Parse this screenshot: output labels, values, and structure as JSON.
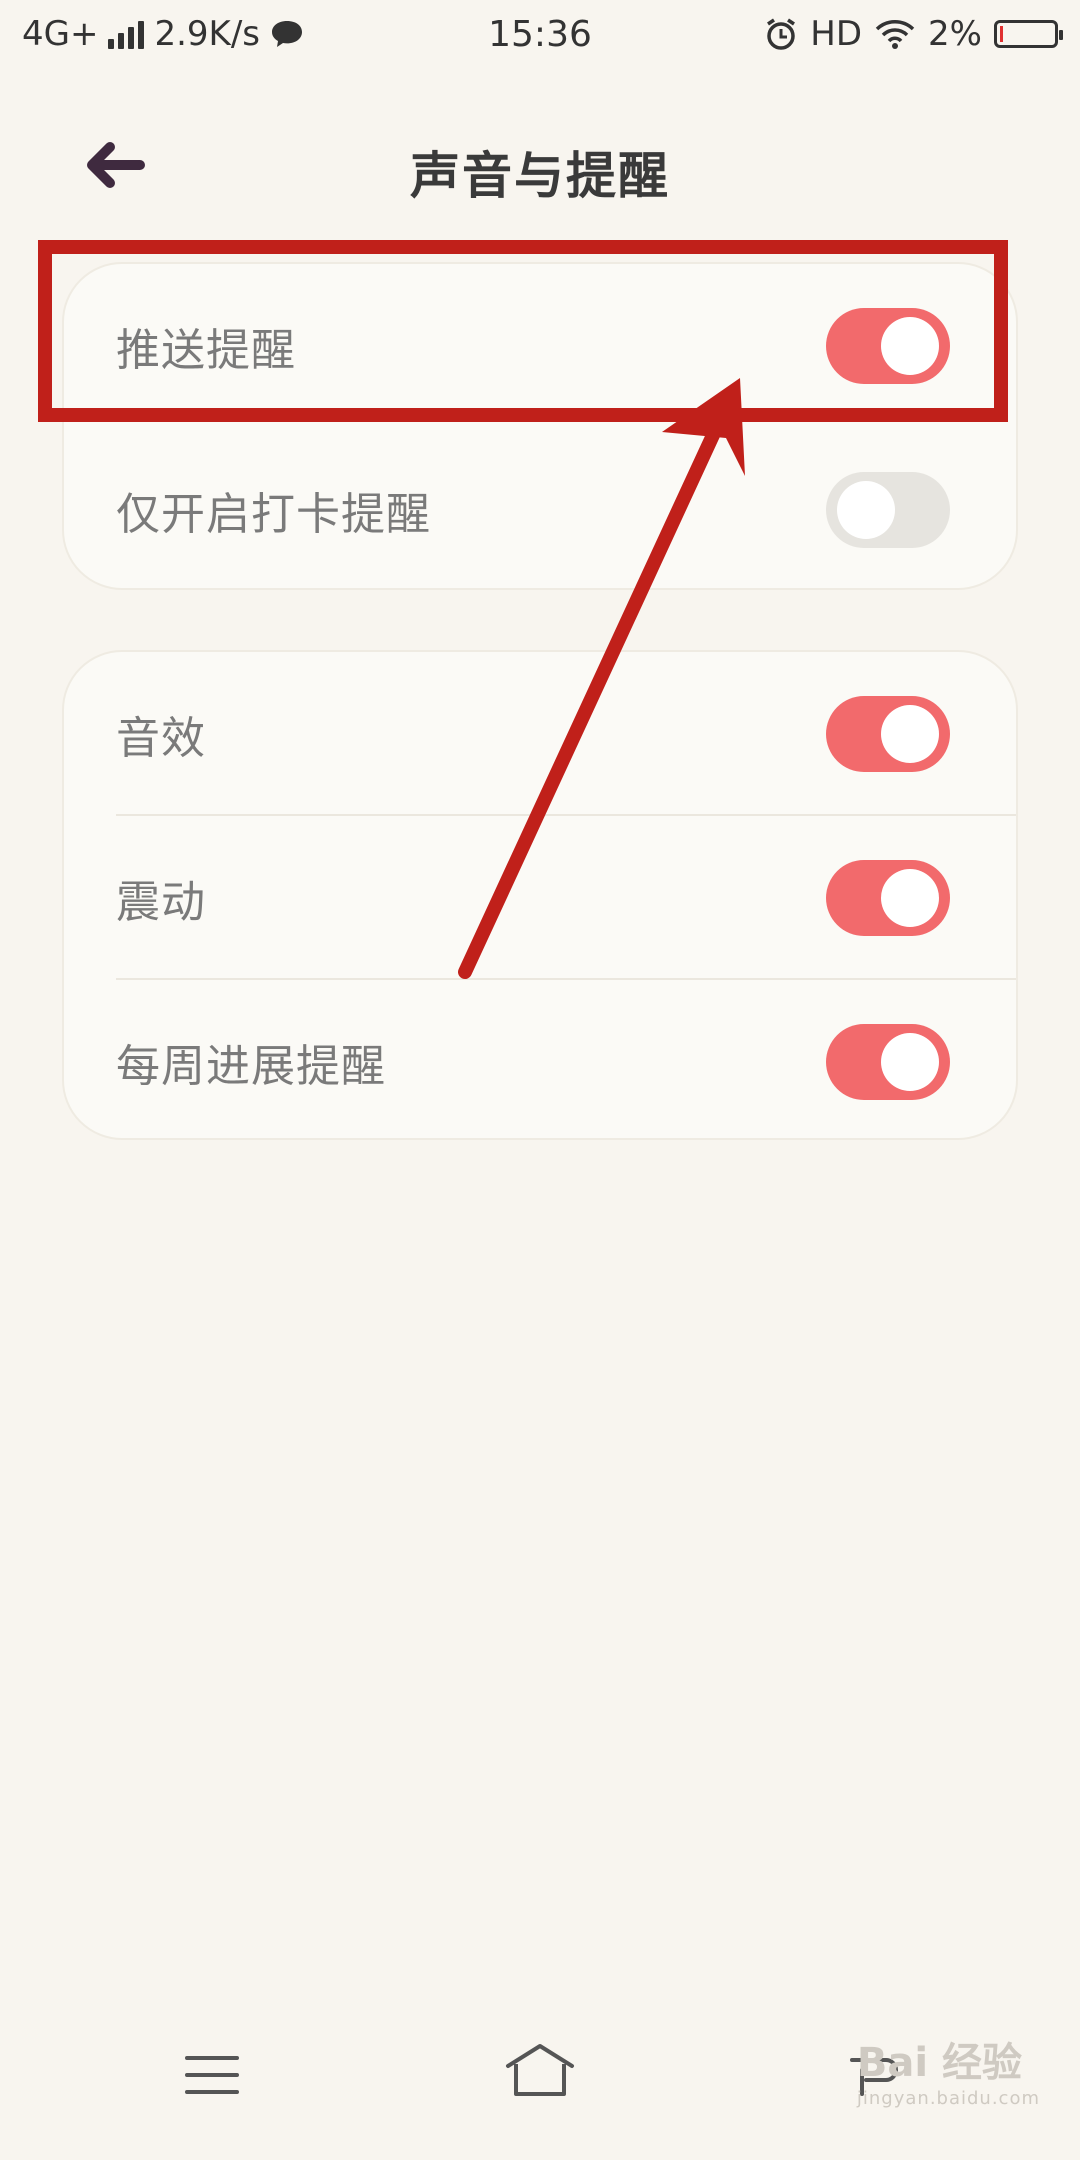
{
  "status_bar": {
    "network": "4G+",
    "speed": "2.9K/s",
    "time": "15:36",
    "hd": "HD",
    "battery_percent": "2%",
    "battery_level": 0.02
  },
  "header": {
    "title": "声音与提醒"
  },
  "settings": {
    "group1": [
      {
        "label": "推送提醒",
        "on": true
      },
      {
        "label": "仅开启打卡提醒",
        "on": false
      }
    ],
    "group2": [
      {
        "label": "音效",
        "on": true
      },
      {
        "label": "震动",
        "on": true
      },
      {
        "label": "每周进展提醒",
        "on": true
      }
    ]
  },
  "watermark": {
    "text": "Bai 经验",
    "sub": "jingyan.baidu.com"
  },
  "colors": {
    "toggle_on": "#f26a6c",
    "toggle_off": "#e6e4df",
    "annotation": "#c0201a",
    "background": "#f8f5ef"
  },
  "icons": {
    "back": "arrow-left-icon",
    "menu": "menu-icon",
    "home": "home-icon",
    "nav_back": "back-nav-icon"
  }
}
